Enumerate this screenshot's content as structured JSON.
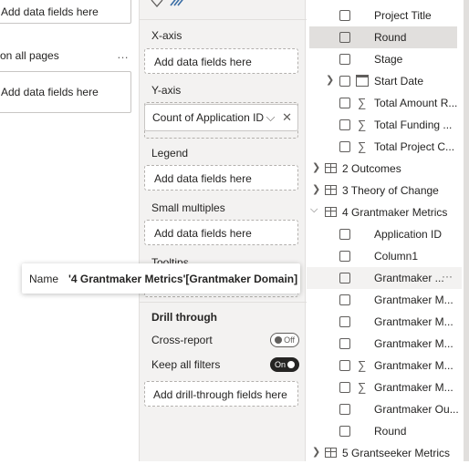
{
  "filters": {
    "top_card_text": "Add data fields here",
    "section_label": "on all pages",
    "section_more": "…",
    "card_text": "Add data fields here"
  },
  "build": {
    "xaxis_title": "X-axis",
    "xaxis_placeholder": "Add data fields here",
    "yaxis_title": "Y-axis",
    "yaxis_field": "Count of Application ID",
    "legend_title": "Legend",
    "legend_placeholder": "Add data fields here",
    "small_multiples_title": "Small multiples",
    "small_multiples_placeholder": "Add data fields here",
    "tooltips_title": "Tooltips",
    "drill_title": "Drill through",
    "cross_report_label": "Cross-report",
    "cross_report_state": "Off",
    "keep_filters_label": "Keep all filters",
    "keep_filters_state": "On",
    "drill_placeholder": "Add drill-through fields here"
  },
  "fields": {
    "rows": [
      {
        "label": "Project Title"
      },
      {
        "label": "Round"
      },
      {
        "label": "Stage"
      },
      {
        "label": "Start Date"
      },
      {
        "label": "Total Amount R..."
      },
      {
        "label": "Total Funding ..."
      },
      {
        "label": "Total Project C..."
      },
      {
        "label": "2 Outcomes"
      },
      {
        "label": "3 Theory of Change"
      },
      {
        "label": "4 Grantmaker Metrics"
      },
      {
        "label": "Application ID"
      },
      {
        "label": "Column1"
      },
      {
        "label": "Grantmaker ...",
        "more": "···"
      },
      {
        "label": "Grantmaker M..."
      },
      {
        "label": "Grantmaker M..."
      },
      {
        "label": "Grantmaker M..."
      },
      {
        "label": "Grantmaker M..."
      },
      {
        "label": "Grantmaker M..."
      },
      {
        "label": "Grantmaker Ou..."
      },
      {
        "label": "Round"
      },
      {
        "label": "5 Grantseeker Metrics"
      }
    ]
  },
  "tooltip": {
    "key": "Name",
    "value": "'4  Grantmaker Metrics'[Grantmaker Domain]"
  }
}
